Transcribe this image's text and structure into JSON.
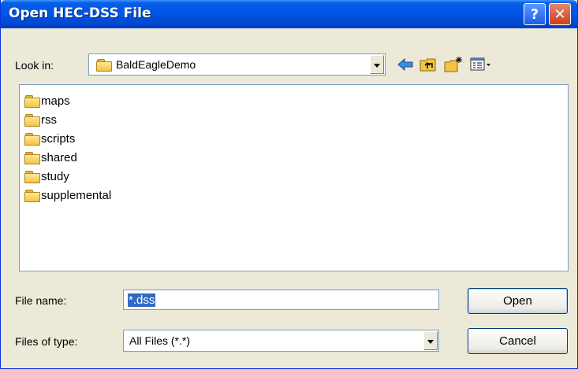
{
  "window": {
    "title": "Open HEC-DSS File",
    "help_label": "?",
    "close_label": "✕"
  },
  "look_in": {
    "label": "Look in:",
    "value": "BaldEagleDemo",
    "icon": "folder-icon"
  },
  "toolbar": {
    "icons": [
      "back-arrow-icon",
      "up-folder-icon",
      "new-folder-icon",
      "view-menu-icon"
    ]
  },
  "files": [
    {
      "name": "maps",
      "icon": "folder-icon"
    },
    {
      "name": "rss",
      "icon": "folder-icon"
    },
    {
      "name": "scripts",
      "icon": "folder-icon"
    },
    {
      "name": "shared",
      "icon": "folder-icon"
    },
    {
      "name": "study",
      "icon": "folder-icon"
    },
    {
      "name": "supplemental",
      "icon": "folder-icon"
    }
  ],
  "file_name": {
    "label": "File name:",
    "value": "*.dss"
  },
  "file_type": {
    "label": "Files of type:",
    "value": "All Files (*.*)"
  },
  "buttons": {
    "open": "Open",
    "cancel": "Cancel"
  },
  "colors": {
    "titlebar": "#0055e5",
    "dialog_bg": "#ece9d8",
    "selection": "#316ac5"
  }
}
